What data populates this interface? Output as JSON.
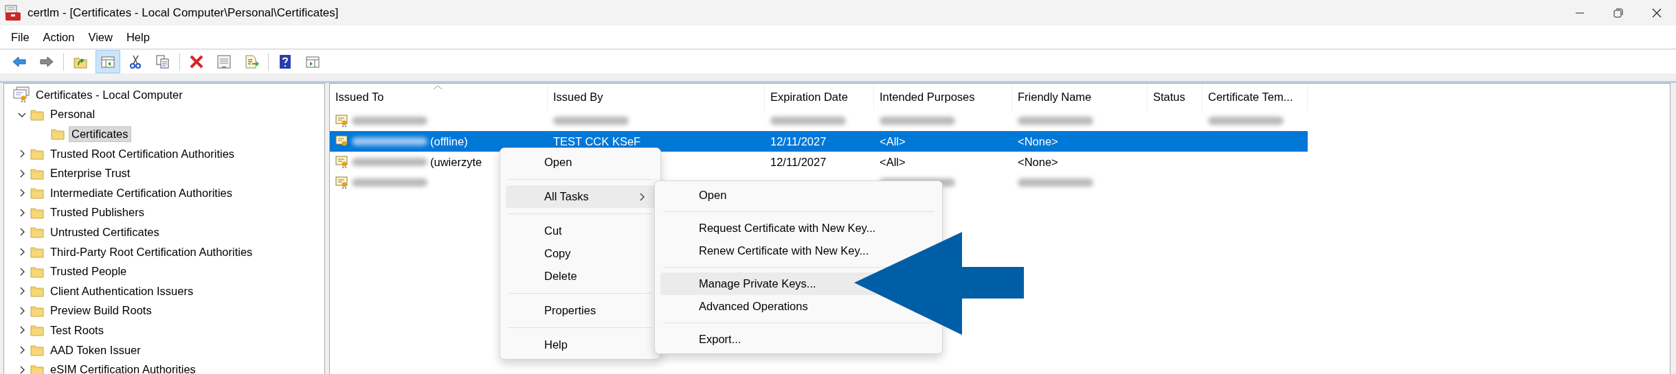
{
  "window": {
    "title": "certlm - [Certificates - Local Computer\\Personal\\Certificates]"
  },
  "menu_bar": [
    "File",
    "Action",
    "View",
    "Help"
  ],
  "toolbar": {
    "groups": [
      {
        "buttons": [
          {
            "kind": "back",
            "pressed": false
          },
          {
            "kind": "forward",
            "pressed": false
          }
        ]
      },
      {
        "buttons": [
          {
            "kind": "up",
            "pressed": false
          },
          {
            "kind": "tree",
            "pressed": true
          },
          {
            "kind": "cut",
            "pressed": false
          },
          {
            "kind": "copy",
            "pressed": false
          }
        ]
      },
      {
        "buttons": [
          {
            "kind": "delete",
            "pressed": false
          },
          {
            "kind": "properties",
            "pressed": false
          },
          {
            "kind": "export",
            "pressed": false
          }
        ]
      },
      {
        "buttons": [
          {
            "kind": "help",
            "pressed": false
          },
          {
            "kind": "view",
            "pressed": false
          }
        ]
      }
    ]
  },
  "tree": {
    "root": "Certificates - Local Computer",
    "items": [
      {
        "label": "Personal",
        "expandable": true,
        "expanded": true,
        "selected": false,
        "children": [
          {
            "label": "Certificates",
            "expandable": false,
            "expanded": false,
            "selected": true
          }
        ]
      },
      {
        "label": "Trusted Root Certification Authorities",
        "expandable": true,
        "expanded": false,
        "selected": false
      },
      {
        "label": "Enterprise Trust",
        "expandable": true,
        "expanded": false,
        "selected": false
      },
      {
        "label": "Intermediate Certification Authorities",
        "expandable": true,
        "expanded": false,
        "selected": false
      },
      {
        "label": "Trusted Publishers",
        "expandable": true,
        "expanded": false,
        "selected": false
      },
      {
        "label": "Untrusted Certificates",
        "expandable": true,
        "expanded": false,
        "selected": false
      },
      {
        "label": "Third-Party Root Certification Authorities",
        "expandable": true,
        "expanded": false,
        "selected": false
      },
      {
        "label": "Trusted People",
        "expandable": true,
        "expanded": false,
        "selected": false
      },
      {
        "label": "Client Authentication Issuers",
        "expandable": true,
        "expanded": false,
        "selected": false
      },
      {
        "label": "Preview Build Roots",
        "expandable": true,
        "expanded": false,
        "selected": false
      },
      {
        "label": "Test Roots",
        "expandable": true,
        "expanded": false,
        "selected": false
      },
      {
        "label": "AAD Token Issuer",
        "expandable": true,
        "expanded": false,
        "selected": false
      },
      {
        "label": "eSIM Certification Authorities",
        "expandable": true,
        "expanded": false,
        "selected": false
      }
    ]
  },
  "table": {
    "columns": [
      {
        "label": "Issued To",
        "sorted": true
      },
      {
        "label": "Issued By",
        "sorted": false
      },
      {
        "label": "Expiration Date",
        "sorted": false
      },
      {
        "label": "Intended Purposes",
        "sorted": false
      },
      {
        "label": "Friendly Name",
        "sorted": false
      },
      {
        "label": "Status",
        "sorted": false
      },
      {
        "label": "Certificate Tem...",
        "sorted": false
      }
    ],
    "rows": [
      {
        "selected": false,
        "cells": [
          {
            "blurred": true
          },
          {
            "blurred": true
          },
          {
            "blurred": true
          },
          {
            "blurred": true
          },
          {
            "blurred": true
          },
          null,
          {
            "blurred": true
          }
        ]
      },
      {
        "selected": true,
        "cells": [
          {
            "blurred": true,
            "text": "(offline)"
          },
          {
            "blurred": false,
            "text": "TEST CCK KSeF"
          },
          {
            "blurred": false,
            "text": "12/11/2027"
          },
          {
            "blurred": false,
            "text": "<All>"
          },
          {
            "blurred": false,
            "text": "<None>"
          },
          null,
          null
        ]
      },
      {
        "selected": false,
        "cells": [
          {
            "blurred": true,
            "text": "(uwierzyte"
          },
          null,
          {
            "blurred": false,
            "text": "12/11/2027"
          },
          {
            "blurred": false,
            "text": "<All>"
          },
          {
            "blurred": false,
            "text": "<None>"
          },
          null,
          null
        ]
      },
      {
        "selected": false,
        "cells": [
          {
            "blurred": true
          },
          null,
          null,
          {
            "blurred": true
          },
          {
            "blurred": true
          },
          null,
          null
        ]
      }
    ]
  },
  "context_menu": {
    "items": [
      {
        "kind": "item",
        "label": "Open",
        "highlighted": false,
        "submenu": false
      },
      {
        "kind": "separator"
      },
      {
        "kind": "item",
        "label": "All Tasks",
        "highlighted": true,
        "submenu": true
      },
      {
        "kind": "separator"
      },
      {
        "kind": "item",
        "label": "Cut",
        "highlighted": false,
        "submenu": false
      },
      {
        "kind": "item",
        "label": "Copy",
        "highlighted": false,
        "submenu": false
      },
      {
        "kind": "item",
        "label": "Delete",
        "highlighted": false,
        "submenu": false
      },
      {
        "kind": "separator"
      },
      {
        "kind": "item",
        "label": "Properties",
        "highlighted": false,
        "submenu": false
      },
      {
        "kind": "separator"
      },
      {
        "kind": "item",
        "label": "Help",
        "highlighted": false,
        "submenu": false
      }
    ]
  },
  "submenu": {
    "items": [
      {
        "kind": "item",
        "label": "Open",
        "highlighted": false
      },
      {
        "kind": "separator"
      },
      {
        "kind": "item",
        "label": "Request Certificate with New Key...",
        "highlighted": false
      },
      {
        "kind": "item",
        "label": "Renew Certificate with New Key...",
        "highlighted": false
      },
      {
        "kind": "separator"
      },
      {
        "kind": "item",
        "label": "Manage Private Keys...",
        "highlighted": true
      },
      {
        "kind": "item",
        "label": "Advanced Operations",
        "highlighted": false
      },
      {
        "kind": "separator"
      },
      {
        "kind": "item",
        "label": "Export...",
        "highlighted": false
      }
    ]
  }
}
